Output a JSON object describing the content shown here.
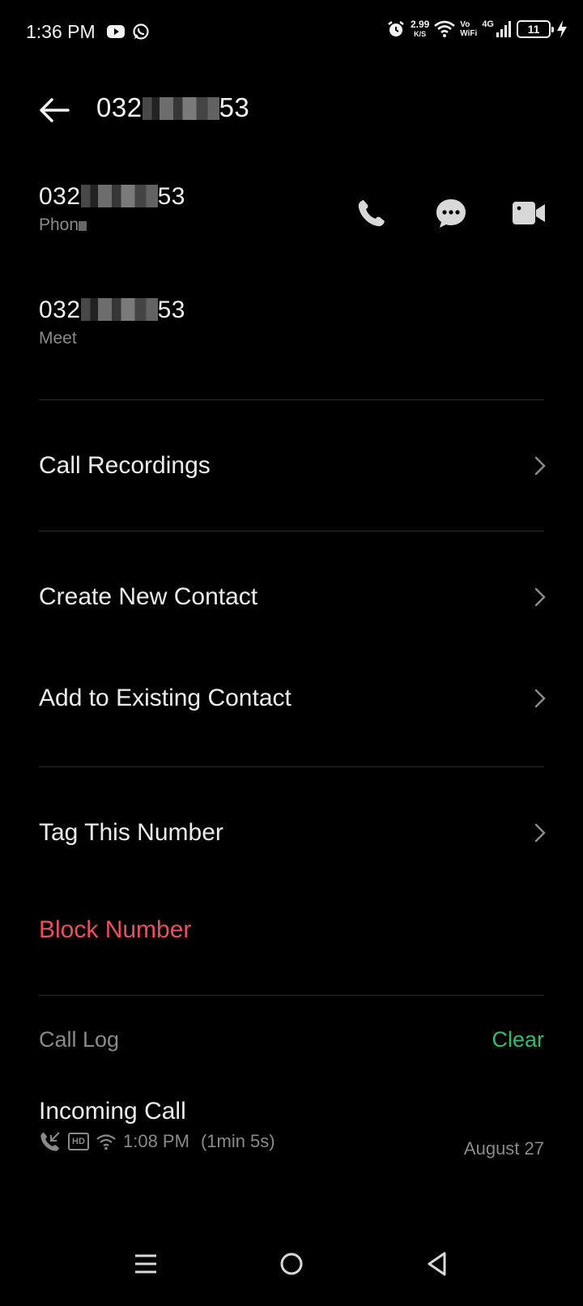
{
  "status_bar": {
    "time": "1:36 PM",
    "speed_value": "2.99",
    "speed_unit": "K/S",
    "vowifi_top": "Vo",
    "vowifi_bottom": "WiFi",
    "network": "4G",
    "battery": "11",
    "icons": [
      "youtube-icon",
      "whatsapp-icon",
      "alarm-icon",
      "wifi-icon",
      "signal-icon",
      "charging-icon"
    ]
  },
  "header": {
    "title_prefix": "032",
    "title_suffix": "53"
  },
  "numbers": [
    {
      "prefix": "032",
      "suffix": "53",
      "label": "Phon"
    },
    {
      "prefix": "032",
      "suffix": "53",
      "label": "Meet"
    }
  ],
  "actions": [
    "call-icon",
    "message-icon",
    "video-call-icon"
  ],
  "menu": {
    "call_recordings": "Call Recordings",
    "create_new_contact": "Create New Contact",
    "add_to_existing": "Add to Existing Contact",
    "tag_number": "Tag This Number",
    "block_number": "Block Number"
  },
  "call_log": {
    "title": "Call Log",
    "clear": "Clear",
    "entries": [
      {
        "type": "Incoming Call",
        "time": "1:08 PM",
        "duration": "(1min 5s)",
        "date": "August 27",
        "badge": "HD"
      }
    ]
  },
  "colors": {
    "background": "#000000",
    "danger": "#e8505b",
    "accent": "#2fbf6c"
  }
}
